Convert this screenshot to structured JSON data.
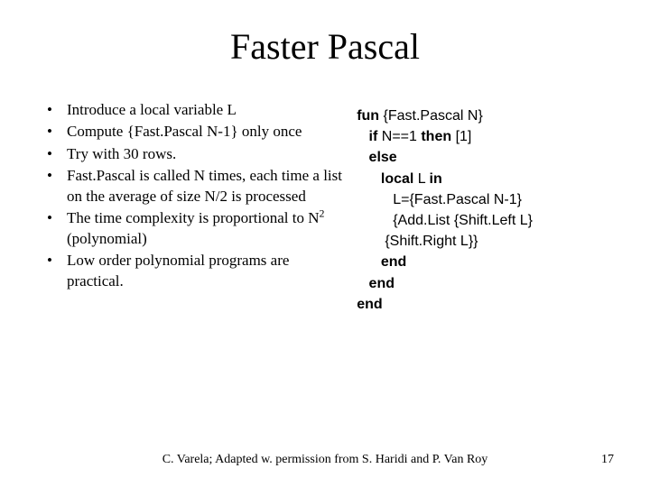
{
  "title": "Faster Pascal",
  "bullets": [
    "Introduce a local variable L",
    "Compute {Fast.Pascal N-1} only once",
    "Try with 30 rows.",
    "Fast.Pascal is called N times, each time a list on the average of size N/2 is processed",
    "The time complexity is proportional to N",
    " (polynomial)",
    "Low order polynomial programs are practical."
  ],
  "sup": "2",
  "code": {
    "l0a": "fun",
    "l0b": " {Fast.Pascal N}",
    "l1a": "   if",
    "l1b": " N==1 ",
    "l1c": "then",
    "l1d": " [1]",
    "l2": "   else",
    "l3a": "      local",
    "l3b": " L ",
    "l3c": "in",
    "l4": "         L={Fast.Pascal N-1}",
    "l5": "         {Add.List {Shift.Left L}",
    "l6": "       {Shift.Right L}}",
    "l7": "      end",
    "l8": "   end",
    "l9": "end"
  },
  "footer_credit": "C. Varela;  Adapted w. permission from S. Haridi and P. Van Roy",
  "page_number": "17"
}
